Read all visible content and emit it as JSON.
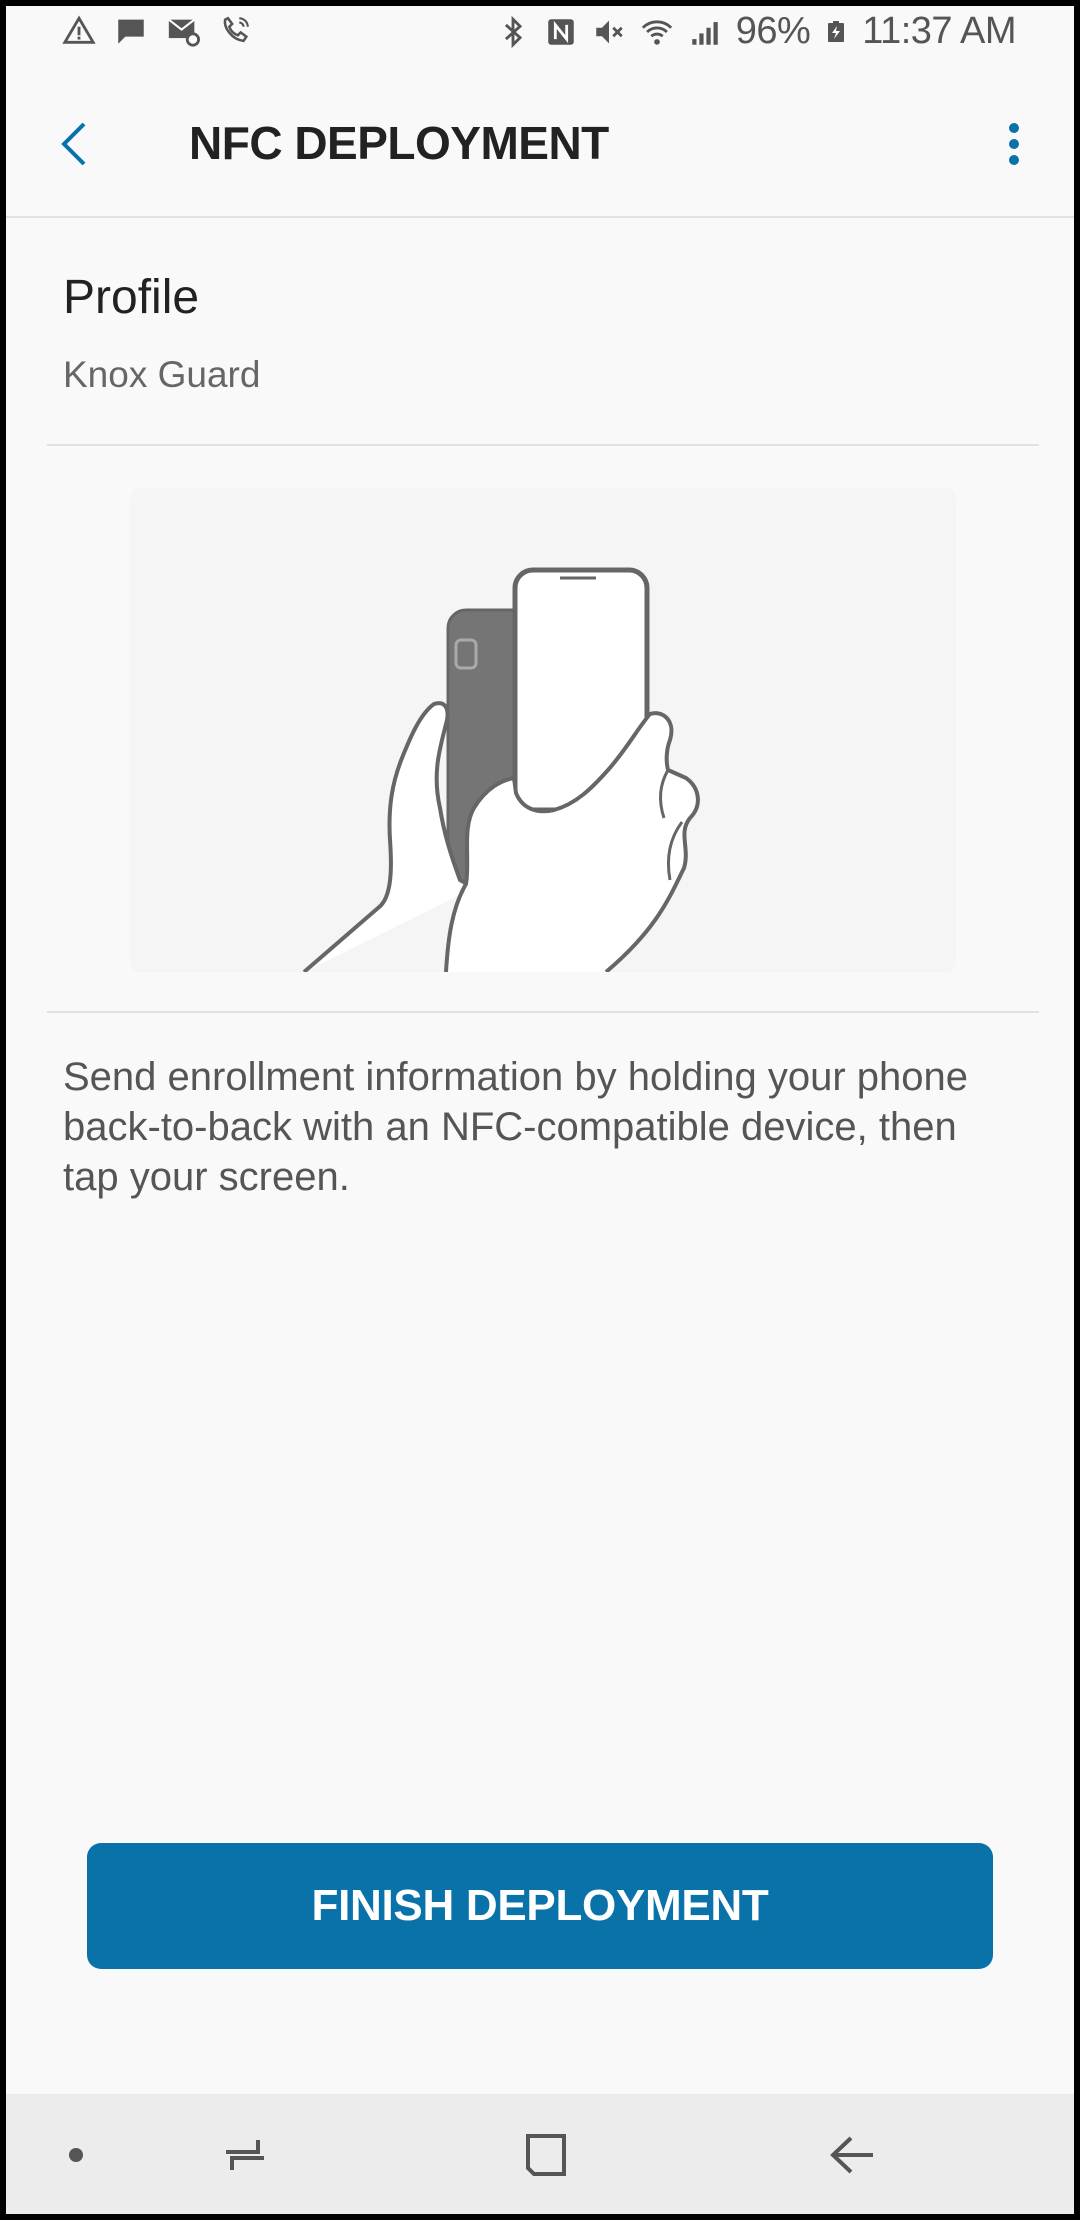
{
  "status_bar": {
    "battery": "96%",
    "time": "11:37 AM",
    "left_icons": [
      "warning-icon",
      "message-icon",
      "mail-settings-icon",
      "wifi-call-icon"
    ],
    "right_icons": [
      "bluetooth-icon",
      "nfc-icon",
      "mute-icon",
      "wifi-icon",
      "signal-icon",
      "battery-charging-icon"
    ]
  },
  "app_bar": {
    "title": "NFC DEPLOYMENT",
    "back_icon": "back-arrow-icon",
    "menu_icon": "more-vert-icon",
    "accent": "#0872a9"
  },
  "profile": {
    "label": "Profile",
    "value": "Knox Guard"
  },
  "instructions": "Send enrollment information by holding your phone back-to-back with an NFC-compatible device, then tap your screen.",
  "finish_button": {
    "label": "FINISH DEPLOYMENT",
    "color": "#0872a9"
  },
  "nav_bar": {
    "icons": [
      "dot-icon",
      "recents-icon",
      "home-icon",
      "back-icon"
    ]
  }
}
